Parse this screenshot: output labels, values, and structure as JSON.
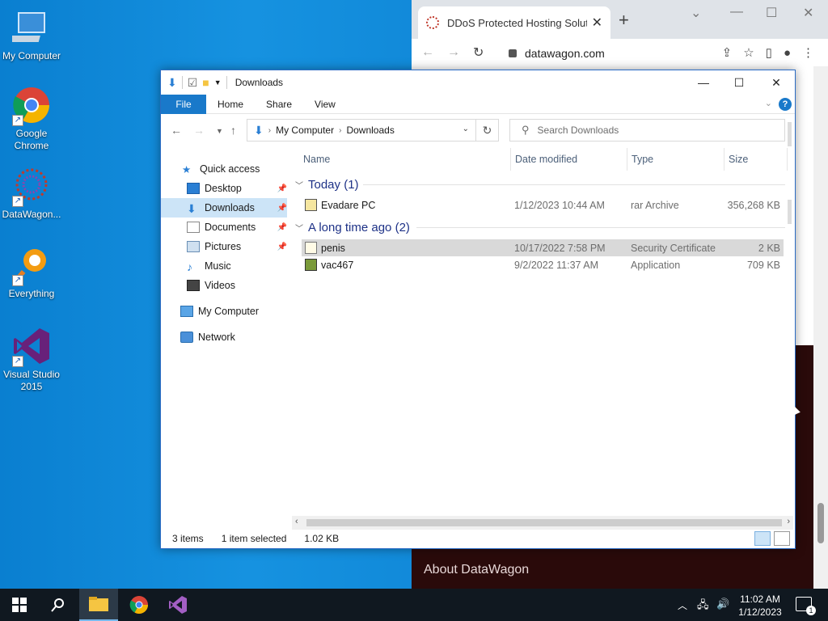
{
  "desktop": {
    "icons": [
      {
        "label": "My Computer",
        "icon": "computer-icon"
      },
      {
        "label": "Google Chrome",
        "icon": "chrome-icon"
      },
      {
        "label": "DataWagon...",
        "icon": "datawagon-icon"
      },
      {
        "label": "Everything",
        "icon": "everything-icon"
      },
      {
        "label": "Visual Studio 2015",
        "icon": "visual-studio-icon"
      }
    ]
  },
  "browser": {
    "tab_title": "DDoS Protected Hosting Solutio",
    "url": "datawagon.com",
    "about_text": "About DataWagon"
  },
  "explorer": {
    "title": "Downloads",
    "ribbon": {
      "file": "File",
      "home": "Home",
      "share": "Share",
      "view": "View"
    },
    "address": {
      "root": "My Computer",
      "current": "Downloads"
    },
    "search_placeholder": "Search Downloads",
    "nav": {
      "quick_access": "Quick access",
      "desktop": "Desktop",
      "downloads": "Downloads",
      "documents": "Documents",
      "pictures": "Pictures",
      "music": "Music",
      "videos": "Videos",
      "my_computer": "My Computer",
      "network": "Network"
    },
    "columns": {
      "name": "Name",
      "date": "Date modified",
      "type": "Type",
      "size": "Size"
    },
    "groups": [
      {
        "label": "Today (1)",
        "files": [
          {
            "name": "Evadare PC",
            "date": "1/12/2023 10:44 AM",
            "type": "rar Archive",
            "size": "356,268 KB"
          }
        ]
      },
      {
        "label": "A long time ago (2)",
        "files": [
          {
            "name": "penis",
            "date": "10/17/2022 7:58 PM",
            "type": "Security Certificate",
            "size": "2 KB"
          },
          {
            "name": "vac467",
            "date": "9/2/2022 11:37 AM",
            "type": "Application",
            "size": "709 KB"
          }
        ]
      }
    ],
    "status": {
      "items": "3 items",
      "selected": "1 item selected",
      "size": "1.02 KB"
    }
  },
  "taskbar": {
    "time": "11:02 AM",
    "date": "1/12/2023",
    "notification_count": "1"
  },
  "colors": {
    "accent": "#1979ca",
    "desktop_bg": "#0f86d6",
    "taskbar_bg": "#101820",
    "group_header": "#1e3287"
  }
}
